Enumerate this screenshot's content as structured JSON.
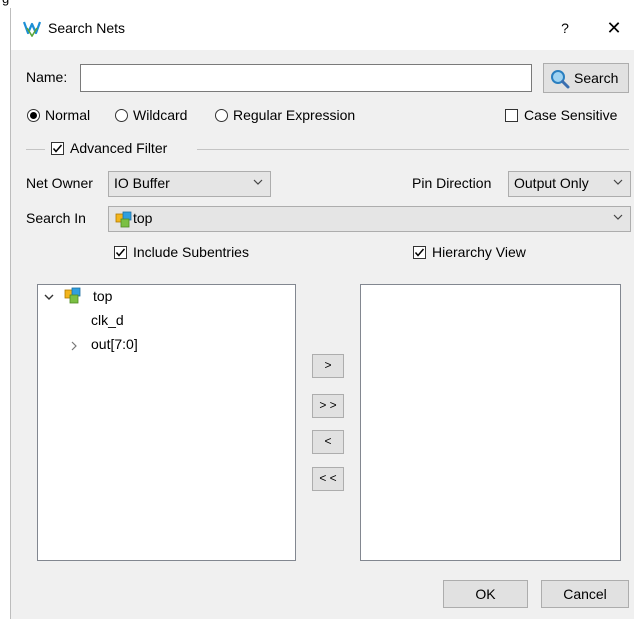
{
  "window": {
    "caption_fragment": "g",
    "title": "Search Nets",
    "help_label": "?",
    "close_label": "✕"
  },
  "icons": {
    "app": "gowin-logo-icon",
    "search": "magnifier-icon",
    "module": "module-cube-icon"
  },
  "name_row": {
    "label": "Name:",
    "value": "",
    "search_button": "Search"
  },
  "match_mode": {
    "options": [
      "Normal",
      "Wildcard",
      "Regular Expression"
    ],
    "selected": "Normal",
    "case_sensitive_label": "Case Sensitive",
    "case_sensitive_checked": false
  },
  "advanced_filter": {
    "label": "Advanced Filter",
    "checked": true
  },
  "net_owner": {
    "label": "Net Owner",
    "value": "IO Buffer"
  },
  "pin_direction": {
    "label": "Pin Direction",
    "value": "Output Only"
  },
  "search_in": {
    "label": "Search In",
    "value": "top"
  },
  "include_subentries": {
    "label": "Include Subentries",
    "checked": true
  },
  "hierarchy_view": {
    "label": "Hierarchy View",
    "checked": true
  },
  "source_tree": {
    "root": {
      "label": "top",
      "expanded": true
    },
    "children": [
      {
        "label": "clk_d",
        "expandable": false
      },
      {
        "label": "out[7:0]",
        "expandable": true
      }
    ]
  },
  "transfer_buttons": {
    "add": ">",
    "add_all": "> >",
    "remove": "<",
    "remove_all": "< <"
  },
  "selected_list": [],
  "footer": {
    "ok": "OK",
    "cancel": "Cancel"
  },
  "colors": {
    "dialog_bg": "#f0f0f0",
    "button_bg": "#e1e1e1",
    "accent_blue": "#1c8fd6",
    "logo_green": "#5aa53a"
  }
}
